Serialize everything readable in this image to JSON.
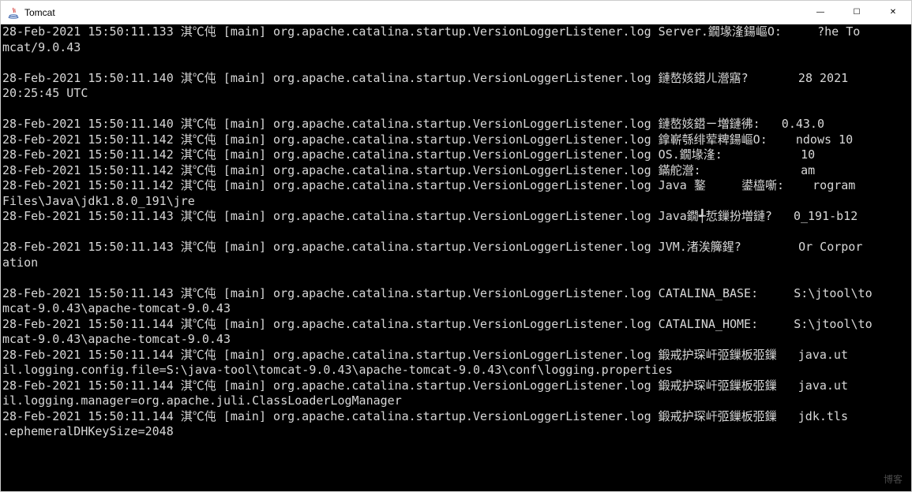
{
  "window": {
    "title": "Tomcat",
    "icon": "java-icon"
  },
  "controls": {
    "minimize": "—",
    "maximize": "☐",
    "close": "✕"
  },
  "watermark": "博客",
  "log_lines": [
    "28-Feb-2021 15:50:11.133 淇℃伅 [main] org.apache.catalina.startup.VersionLoggerListener.log Server.鐗堟湰鍚嶇О:     ?he Tomcat/9.0.43",
    "",
    "28-Feb-2021 15:50:11.140 淇℃伅 [main] org.apache.catalina.startup.VersionLoggerListener.log 鏈嶅姟鍣ㄦ瀯寤?       28 2021 20:25:45 UTC",
    "",
    "28-Feb-2021 15:50:11.140 淇℃伅 [main] org.apache.catalina.startup.VersionLoggerListener.log 鏈嶅姟鍣ㄧ増鏈彿:   0.43.0",
    "28-Feb-2021 15:50:11.142 淇℃伅 [main] org.apache.catalina.startup.VersionLoggerListener.log 鎿嶄綔绯荤粺鍚嶇О:    ndows 10",
    "28-Feb-2021 15:50:11.142 淇℃伅 [main] org.apache.catalina.startup.VersionLoggerListener.log OS.鐗堟湰:           10",
    "28-Feb-2021 15:50:11.142 淇℃伅 [main] org.apache.catalina.startup.VersionLoggerListener.log 鏋舵瀯:              am",
    "28-Feb-2021 15:50:11.142 淇℃伅 [main] org.apache.catalina.startup.VersionLoggerListener.log Java 鐜     鍙橀噺:    rogram Files\\Java\\jdk1.8.0_191\\jre",
    "28-Feb-2021 15:50:11.143 淇℃伅 [main] org.apache.catalina.startup.VersionLoggerListener.log Java鐗╃悊鏁扮増鏈?   0_191-b12",
    "",
    "28-Feb-2021 15:50:11.143 淇℃伅 [main] org.apache.catalina.startup.VersionLoggerListener.log JVM.渚涘簲鍟?        Or Corporation",
    "",
    "28-Feb-2021 15:50:11.143 淇℃伅 [main] org.apache.catalina.startup.VersionLoggerListener.log CATALINA_BASE:     S:\\jtool\\tomcat-9.0.43\\apache-tomcat-9.0.43",
    "28-Feb-2021 15:50:11.144 淇℃伅 [main] org.apache.catalina.startup.VersionLoggerListener.log CATALINA_HOME:     S:\\jtool\\tomcat-9.0.43\\apache-tomcat-9.0.43",
    "28-Feb-2021 15:50:11.144 淇℃伅 [main] org.apache.catalina.startup.VersionLoggerListener.log 鍛戒护琛屽弬鏁板弬鏁   java.util.logging.config.file=S:\\java-tool\\tomcat-9.0.43\\apache-tomcat-9.0.43\\conf\\logging.properties",
    "28-Feb-2021 15:50:11.144 淇℃伅 [main] org.apache.catalina.startup.VersionLoggerListener.log 鍛戒护琛屽弬鏁板弬鏁   java.util.logging.manager=org.apache.juli.ClassLoaderLogManager",
    "28-Feb-2021 15:50:11.144 淇℃伅 [main] org.apache.catalina.startup.VersionLoggerListener.log 鍛戒护琛屽弬鏁板弬鏁   jdk.tls.ephemeralDHKeySize=2048"
  ]
}
